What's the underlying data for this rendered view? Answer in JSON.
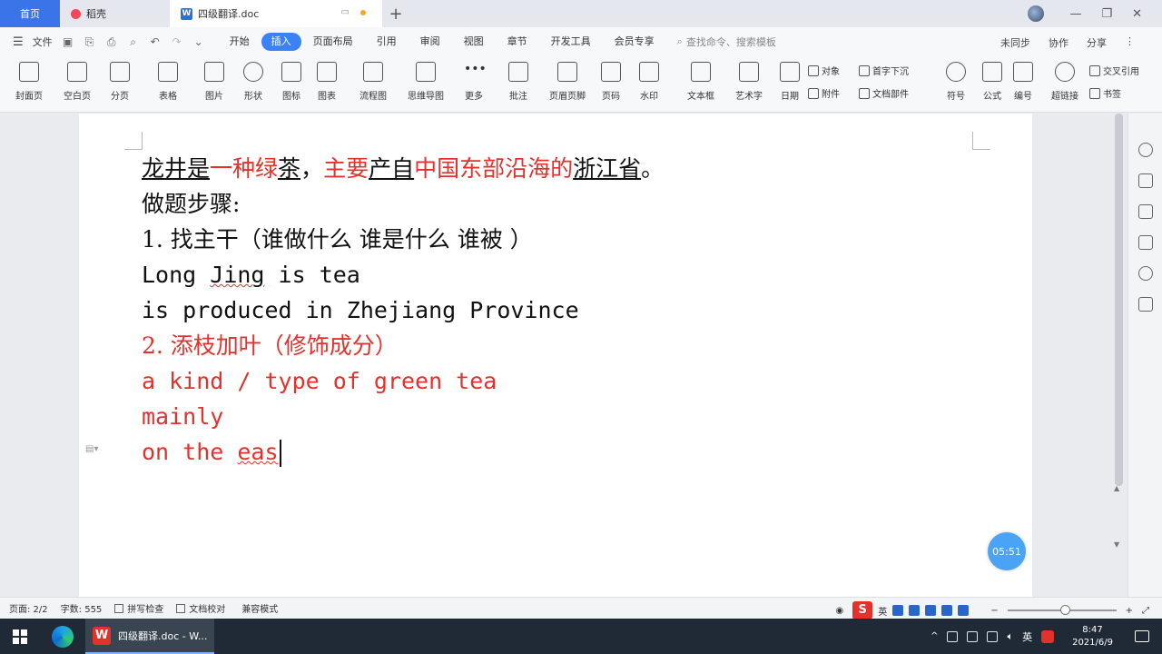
{
  "tabs": {
    "home": "首页",
    "daoke": "稻壳",
    "doc": "四级翻译.doc"
  },
  "menu": {
    "file": "文件",
    "tabs": [
      "开始",
      "插入",
      "页面布局",
      "引用",
      "审阅",
      "视图",
      "章节",
      "开发工具",
      "会员专享"
    ],
    "active_tab": "插入",
    "search": "查找命令、搜索模板",
    "right": [
      "未同步",
      "协作",
      "分享"
    ]
  },
  "ribbon": {
    "items": [
      "封面页",
      "空白页",
      "分页",
      "表格",
      "图片",
      "形状",
      "图标",
      "图表",
      "流程图",
      "思维导图",
      "更多",
      "批注",
      "页眉页脚",
      "页码",
      "水印",
      "文本框",
      "艺术字",
      "日期"
    ],
    "small": [
      "对象",
      "首字下沉",
      "附件",
      "文档部件",
      "符号",
      "公式",
      "编号",
      "超链接",
      "交叉引用",
      "书签"
    ]
  },
  "document": {
    "line1": {
      "p1": "龙井是",
      "p2": "一种绿",
      "p3": "茶",
      "p4": "，",
      "p5": "主要",
      "p6": "产自",
      "p7": "中国东部沿海的",
      "p8": "浙江省",
      "p9": "。"
    },
    "line2": "做题步骤:",
    "line3": "1.  找主干（谁做什么  谁是什么  谁被 ）",
    "line4_a": "Long ",
    "line4_b": "Jing",
    "line4_c": " is tea",
    "line5": "is produced in Zhejiang Province",
    "line6": "2.  添枝加叶（修饰成分）",
    "line7": "a kind / type of green tea",
    "line8": "mainly",
    "line9_a": "on the ",
    "line9_b": "eas"
  },
  "timer": "05:51",
  "status": {
    "page": "页面: 2/2",
    "words": "字数: 555",
    "spell": "拼写检查",
    "proof": "文档校对",
    "compat": "兼容模式"
  },
  "taskbar": {
    "app": "四级翻译.doc - W...",
    "lang": "英",
    "time": "8:47",
    "date": "2021/6/9"
  },
  "colors": {
    "accent": "#3b82f6",
    "red_text": "#e4312c",
    "home_tab": "#3b73e8"
  }
}
